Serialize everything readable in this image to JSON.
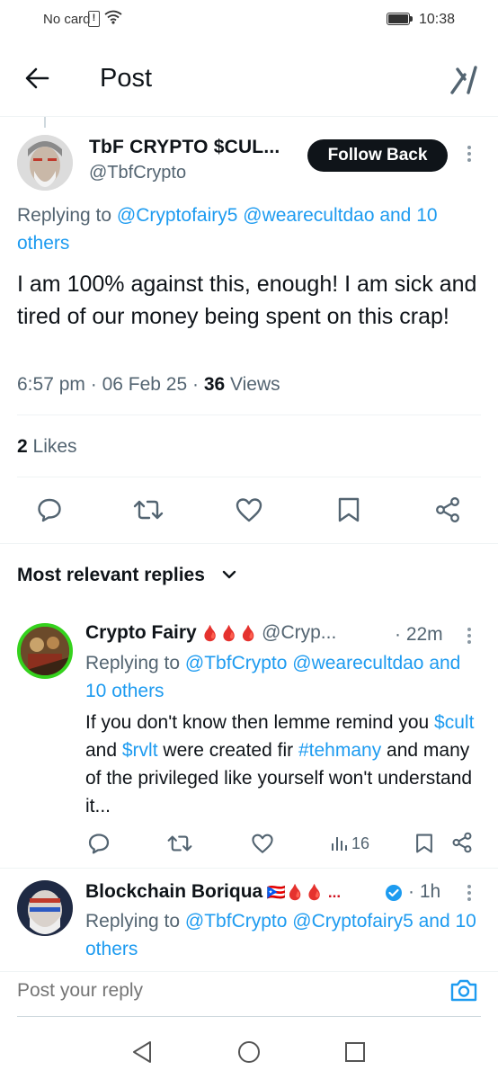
{
  "status_bar": {
    "carrier": "No card",
    "sim_badge": "!",
    "time": "10:38"
  },
  "header": {
    "title": "Post"
  },
  "post": {
    "author_name": "TbF CRYPTO $CUL...",
    "author_handle": "@TbfCrypto",
    "follow_label": "Follow Back",
    "replying_prefix": "Replying to ",
    "replying_links": "@Cryptofairy5 @wearecultdao and 10 others",
    "text": "I am 100% against this, enough! I am sick and tired of our money being spent on this crap!",
    "time": "6:57 pm",
    "date": "06 Feb 25",
    "views_count": "36",
    "views_label": "Views",
    "likes_count": "2",
    "likes_label": "Likes"
  },
  "replies_header": {
    "label": "Most relevant replies"
  },
  "replies": [
    {
      "name": "Crypto Fairy",
      "emojis": "🩸🩸🩸",
      "handle": "@Cryp...",
      "time": "· 22m",
      "replying_prefix": "Replying to ",
      "replying_links": "@TbfCrypto @wearecultdao and 10 others",
      "text_1": "If you don't know then lemme remind you ",
      "cashtag_1": "$cult",
      "text_2": " and ",
      "cashtag_2": "$rvlt",
      "text_3": " were created fir ",
      "hashtag": "#tehmany",
      "text_4": " and many of the privileged like yourself won't understand it...",
      "views": "16"
    },
    {
      "name": "Blockchain Boriqua",
      "emojis": "🇵🇷🩸🩸 ...",
      "time": "· 1h",
      "replying_prefix": "Replying to ",
      "replying_links": "@TbfCrypto @Cryptofairy5 and 10 others"
    }
  ],
  "reply_composer": {
    "placeholder": "Post your reply"
  },
  "colors": {
    "accent": "#1d9bf0",
    "text": "#0f1419",
    "muted": "#536471",
    "verified": "#1d9bf0",
    "online_ring": "#35d21d"
  },
  "icons": [
    "back-arrow-icon",
    "grok-icon",
    "more-icon",
    "reply-icon",
    "repost-icon",
    "like-icon",
    "bookmark-icon",
    "share-icon",
    "chevron-down-icon",
    "views-icon",
    "verified-icon",
    "camera-icon",
    "nav-back-icon",
    "nav-home-icon",
    "nav-recents-icon"
  ]
}
